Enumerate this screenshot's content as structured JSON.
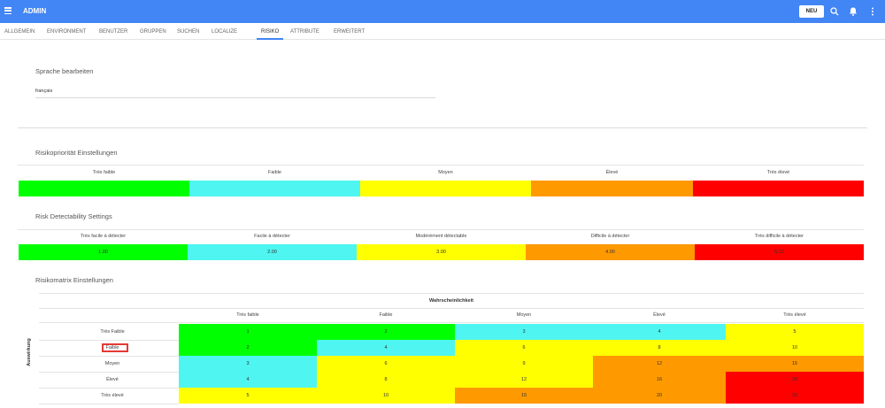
{
  "header": {
    "title": "ADMIN",
    "new_label": "NEU",
    "brand_color": "#4285f4"
  },
  "tabs": [
    "ALLGEMEIN",
    "ENVIRONMENT",
    "BENUTZER",
    "GRUPPEN",
    "SUCHEN",
    "LOCALIZE",
    "RISIKO",
    "ATTRIBUTE",
    "ERWEITERT"
  ],
  "active_tab": "RISIKO",
  "language": {
    "title": "Sprache bearbeiten",
    "value": "français"
  },
  "priority": {
    "title": "Risikopriorität Einstellungen",
    "levels": [
      "Très faible",
      "Faible",
      "Moyen",
      "Élevé",
      "Très élevé"
    ],
    "colors": [
      "#00ff00",
      "#4ff5f0",
      "#ffff00",
      "#ff9900",
      "#ff0000"
    ]
  },
  "detectability": {
    "title": "Risk Detectability Settings",
    "levels": [
      "Très facile à détecter",
      "Facile à détecter",
      "Modérément détectable",
      "Difficile à détecter",
      "Très difficile à détecter"
    ],
    "values": [
      "1.00",
      "2.00",
      "3.00",
      "4.00",
      "5.00"
    ],
    "colors": [
      "#00ff00",
      "#4ff5f0",
      "#ffff00",
      "#ff9900",
      "#ff0000"
    ]
  },
  "matrix": {
    "title": "Risikomatrix Einstellungen",
    "x_axis": "Wahrscheinlichkeit",
    "y_axis": "Auswirkung",
    "columns": [
      "Très faible",
      "Faible",
      "Moyen",
      "Élevé",
      "Très élevé"
    ],
    "rows": [
      {
        "label": "Très Faible",
        "values": [
          "1",
          "2",
          "3",
          "4",
          "5"
        ],
        "levels": [
          0,
          0,
          1,
          1,
          2
        ]
      },
      {
        "label": "Faible",
        "values": [
          "2",
          "4",
          "6",
          "8",
          "10"
        ],
        "levels": [
          0,
          1,
          2,
          2,
          2
        ]
      },
      {
        "label": "Moyen",
        "values": [
          "3",
          "6",
          "9",
          "12",
          "15"
        ],
        "levels": [
          1,
          2,
          2,
          3,
          3
        ]
      },
      {
        "label": "Élevé",
        "values": [
          "4",
          "8",
          "12",
          "16",
          "20"
        ],
        "levels": [
          1,
          2,
          2,
          3,
          4
        ]
      },
      {
        "label": "Très élevé",
        "values": [
          "5",
          "10",
          "15",
          "20",
          "25"
        ],
        "levels": [
          2,
          2,
          3,
          3,
          4
        ]
      }
    ],
    "highlighted_row": "Faible",
    "highlight_color": "#e53935"
  }
}
